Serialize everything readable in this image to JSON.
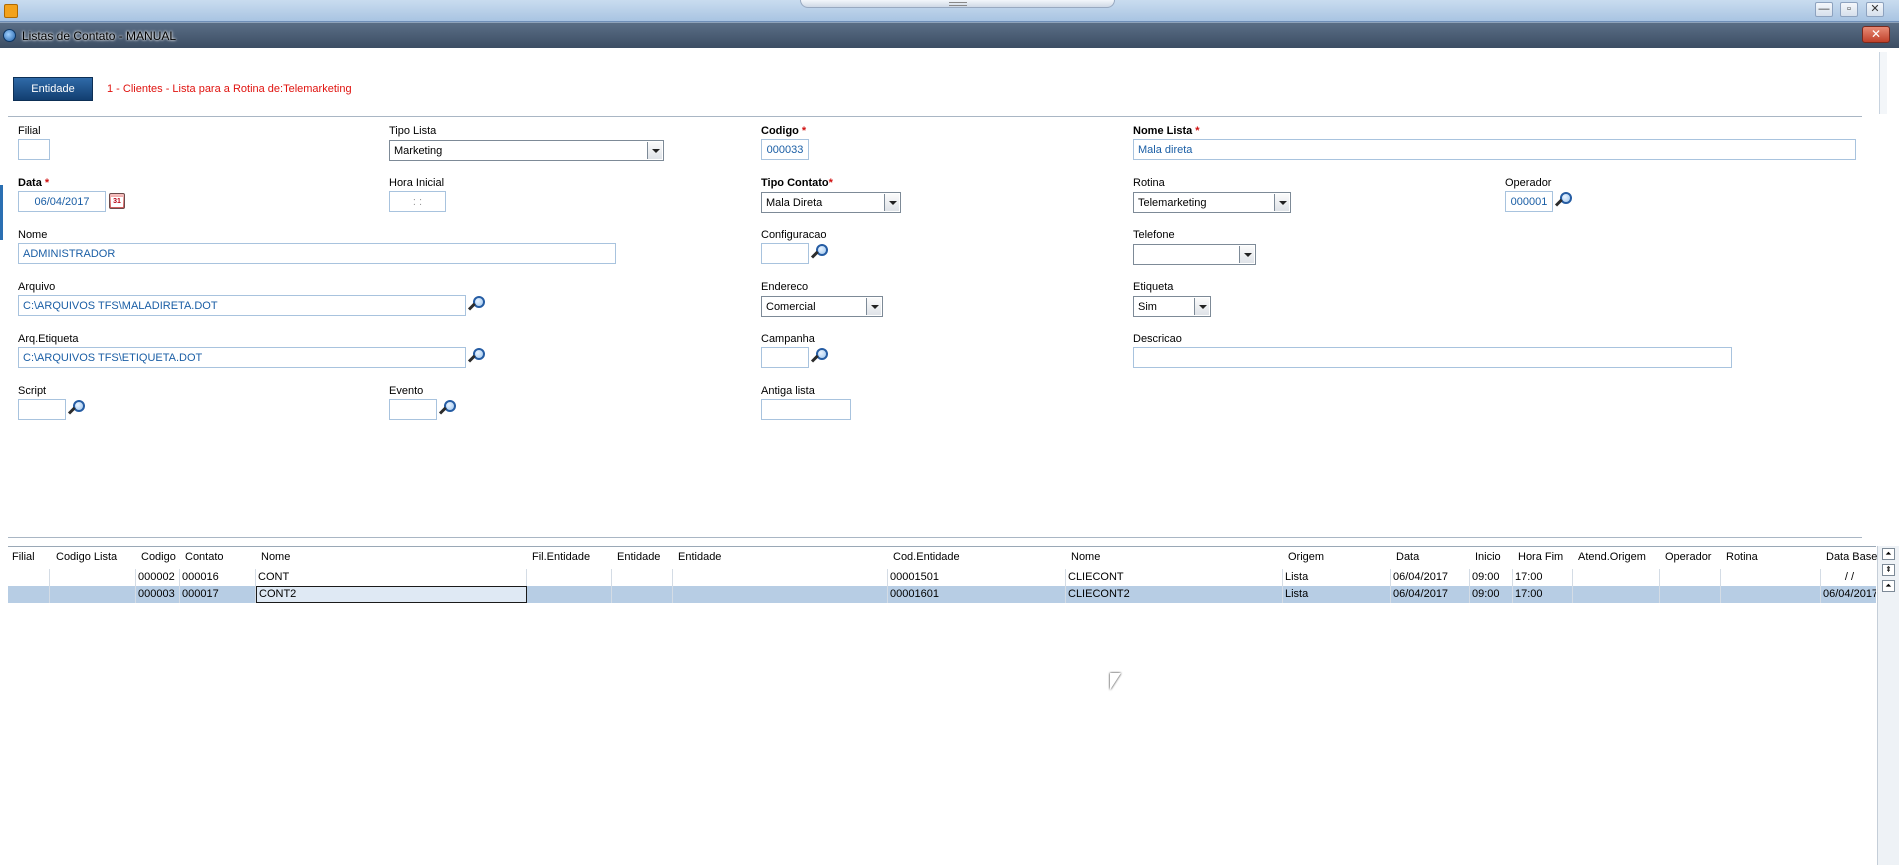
{
  "window": {
    "title": "Listas de Contato - MANUAL",
    "close_glyph": "✕"
  },
  "os_controls": {
    "minimize": "—",
    "maximize": "▫",
    "close": "✕"
  },
  "entity_bar": {
    "button_label": "Entidade",
    "description": "1 - Clientes - Lista para a Rotina de:Telemarketing"
  },
  "form": {
    "filial": {
      "label": "Filial",
      "value": ""
    },
    "tipo_lista": {
      "label": "Tipo Lista",
      "value": "Marketing"
    },
    "codigo": {
      "label": "Codigo",
      "required": "*",
      "value": "000033"
    },
    "nome_lista": {
      "label": "Nome Lista",
      "required": "*",
      "value": "Mala direta"
    },
    "data": {
      "label": "Data",
      "required": "*",
      "value": "06/04/2017",
      "calendar_glyph": "31"
    },
    "hora_inicial": {
      "label": "Hora Inicial",
      "value": " :  : "
    },
    "tipo_contato": {
      "label": "Tipo Contato",
      "required": "*",
      "value": "Mala Direta"
    },
    "rotina": {
      "label": "Rotina",
      "value": "Telemarketing"
    },
    "operador": {
      "label": "Operador",
      "value": "000001"
    },
    "nome": {
      "label": "Nome",
      "value": "ADMINISTRADOR"
    },
    "configuracao": {
      "label": "Configuracao",
      "value": ""
    },
    "telefone": {
      "label": "Telefone",
      "value": ""
    },
    "arquivo": {
      "label": "Arquivo",
      "value": "C:\\ARQUIVOS TFS\\MALADIRETA.DOT"
    },
    "endereco": {
      "label": "Endereco",
      "value": "Comercial"
    },
    "etiqueta": {
      "label": "Etiqueta",
      "value": "Sim"
    },
    "arq_etiqueta": {
      "label": "Arq.Etiqueta",
      "value": "C:\\ARQUIVOS TFS\\ETIQUETA.DOT"
    },
    "campanha": {
      "label": "Campanha",
      "value": ""
    },
    "descricao": {
      "label": "Descricao",
      "value": ""
    },
    "script": {
      "label": "Script",
      "value": ""
    },
    "evento": {
      "label": "Evento",
      "value": ""
    },
    "antiga_lista": {
      "label": "Antiga lista",
      "value": ""
    }
  },
  "grid": {
    "columns": [
      "Filial",
      "Codigo Lista",
      "Codigo",
      "Contato",
      "Nome",
      "Fil.Entidade",
      "Entidade",
      "Entidade",
      "Cod.Entidade",
      "Nome",
      "Origem",
      "Data",
      "Inicio",
      "Hora Fim",
      "Atend.Origem",
      "Operador",
      "Rotina",
      "Data Base"
    ],
    "rows": [
      [
        "",
        "",
        "000002",
        "000016",
        "CONT",
        "",
        "",
        "",
        "00001501",
        "CLIECONT",
        "Lista",
        "06/04/2017",
        "09:00",
        "17:00",
        "",
        "",
        "",
        " /  / "
      ],
      [
        "",
        "",
        "000003",
        "000017",
        "CONT2",
        "",
        "",
        "",
        "00001601",
        "CLIECONT2",
        "Lista",
        "06/04/2017",
        "09:00",
        "17:00",
        "",
        "",
        "",
        "06/04/2017"
      ]
    ],
    "selected_row": 1,
    "scroll_buttons": [
      "⏶",
      "⇞",
      "⏶"
    ]
  }
}
